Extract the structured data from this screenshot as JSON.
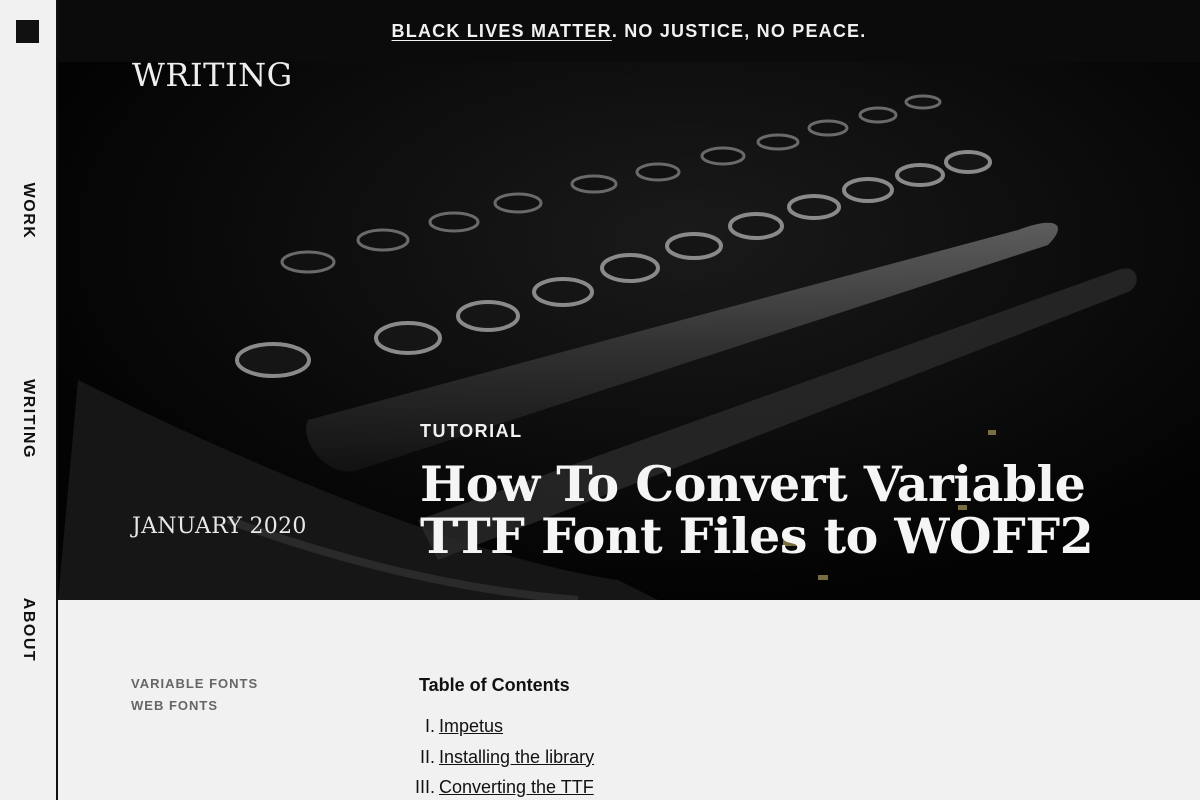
{
  "sidebar": {
    "nav": [
      {
        "label": "WORK"
      },
      {
        "label": "WRITING"
      },
      {
        "label": "ABOUT"
      }
    ]
  },
  "banner": {
    "link_text": "BLACK LIVES MATTER",
    "rest_text": ". NO JUSTICE, NO PEACE."
  },
  "hero": {
    "section_label": "WRITING",
    "date": "JANUARY 2020",
    "category": "TUTORIAL",
    "title": "How To Convert Variable TTF Font Files to WOFF2",
    "image_icon": "typewriter-keys-photo"
  },
  "article": {
    "tags": [
      "VARIABLE FONTS",
      "WEB FONTS"
    ],
    "toc_title": "Table of Contents",
    "toc": [
      {
        "num": "I.",
        "label": "Impetus"
      },
      {
        "num": "II.",
        "label": "Installing the library"
      },
      {
        "num": "III.",
        "label": "Converting the TTF"
      }
    ]
  },
  "colors": {
    "background": "#f1f1f1",
    "hero_background": "#050505",
    "text": "#111111",
    "muted": "#666666"
  }
}
